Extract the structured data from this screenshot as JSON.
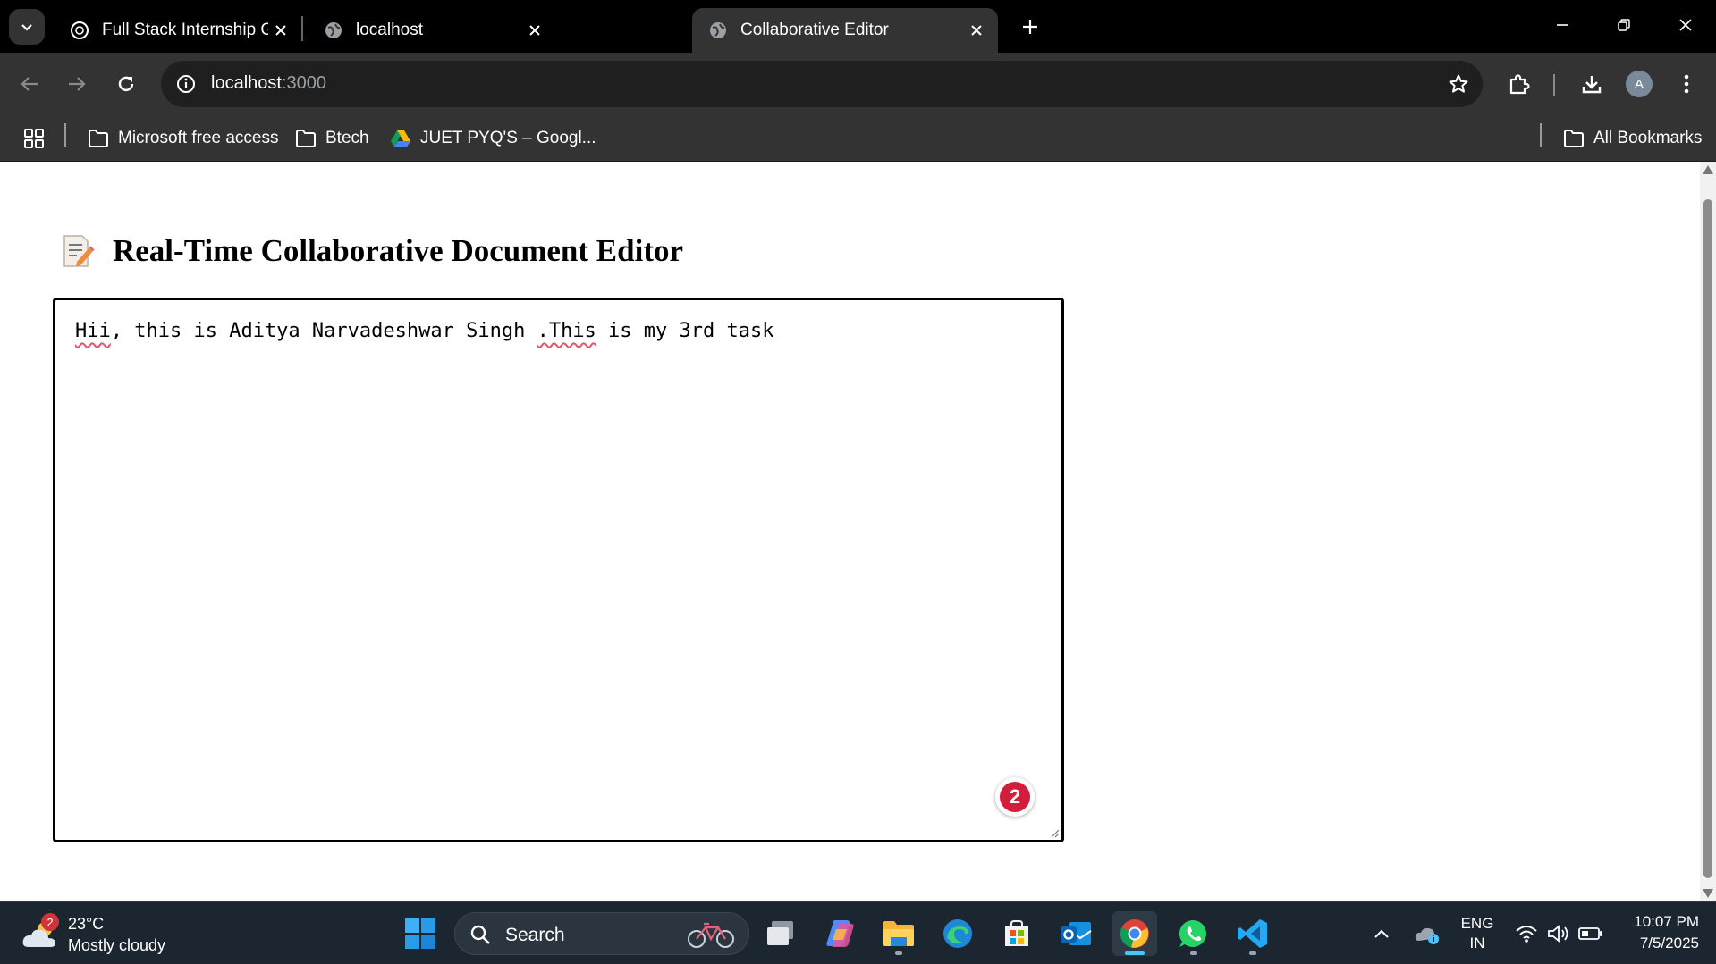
{
  "browser": {
    "tabs": [
      {
        "title": "Full Stack Internship Guide",
        "active": false
      },
      {
        "title": "localhost",
        "active": false
      },
      {
        "title": "Collaborative Editor",
        "active": true
      }
    ],
    "url_host": "localhost",
    "url_port": ":3000",
    "profile_initial": "A",
    "bookmarks": [
      {
        "label": "Microsoft free access",
        "icon": "folder-icon"
      },
      {
        "label": "Btech",
        "icon": "folder-icon"
      },
      {
        "label": "JUET PYQ'S – Googl...",
        "icon": "google-drive-icon"
      }
    ],
    "all_bookmarks_label": "All Bookmarks"
  },
  "page": {
    "heading_emoji": "memo-icon",
    "heading": "Real-Time Collaborative Document Editor",
    "editor": {
      "segments": [
        {
          "text": "Hii",
          "misspelled": true
        },
        {
          "text": ", this is Aditya Narvadeshwar Singh ",
          "misspelled": false
        },
        {
          "text": ".This",
          "misspelled": true
        },
        {
          "text": " is my 3rd task",
          "misspelled": false
        }
      ]
    },
    "extension_badge_count": "2"
  },
  "taskbar": {
    "weather_badge": "2",
    "temperature": "23°C",
    "condition": "Mostly cloudy",
    "search_label": "Search",
    "language_line1": "ENG",
    "language_line2": "IN",
    "time": "10:07 PM",
    "date": "7/5/2025"
  },
  "colors": {
    "tab_active_bg": "#333333",
    "toolbar_bg": "#333333",
    "taskbar_bg": "#1c2630",
    "spell_underline": "#e8536b",
    "badge_red": "#d01e3c"
  }
}
